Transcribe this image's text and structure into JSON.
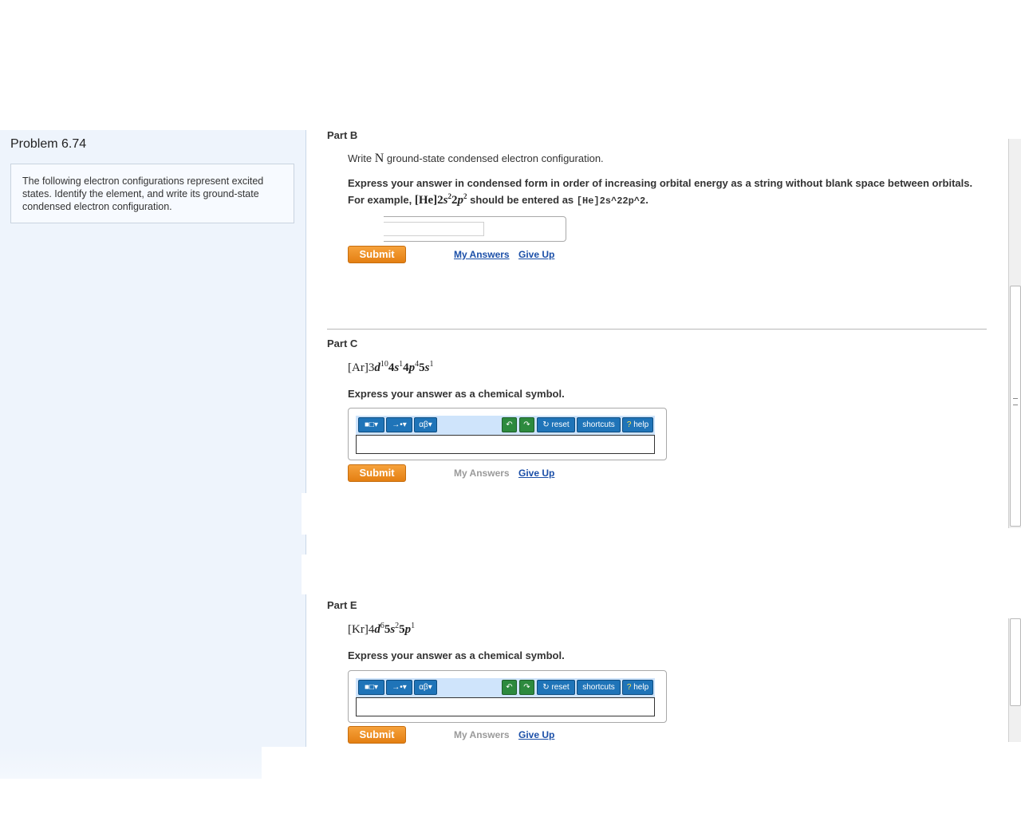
{
  "sidebar": {
    "title": "Problem 6.74",
    "description": "The following electron configurations represent excited states. Identify the element, and write its ground-state condensed electron configuration."
  },
  "part_b": {
    "title": "Part B",
    "q_prefix": "Write",
    "q_symbol": "N",
    "q_suffix": "ground-state condensed electron configuration.",
    "instruction_line1": "Express your answer in condensed form in order of increasing orbital energy as a string without blank space between orbitals.",
    "instruction_prefix": "For example,",
    "instruction_mid": "should be entered as",
    "example_code": "[He]2s^22p^2",
    "instruction_end": ".",
    "input_value": "",
    "submit_label": "Submit",
    "my_answers_label": "My Answers",
    "give_up_label": "Give Up"
  },
  "part_c": {
    "title": "Part C",
    "instruction": "Express your answer as a chemical symbol.",
    "submit_label": "Submit",
    "my_answers_label": "My Answers",
    "give_up_label": "Give Up"
  },
  "part_e": {
    "title": "Part E",
    "instruction": "Express your answer as a chemical symbol.",
    "submit_label": "Submit",
    "my_answers_label": "My Answers",
    "give_up_label": "Give Up"
  },
  "toolbar": {
    "templates_icon": "templates-icon",
    "arrow_icon": "arrow-icon",
    "greek_label": "αβ",
    "undo_icon": "undo-icon",
    "redo_icon": "redo-icon",
    "reset_label": "reset",
    "shortcuts_label": "shortcuts",
    "help_label": "help"
  },
  "colors": {
    "submit": "#e8891c",
    "link": "#1b4fa8",
    "sidebar_bg": "#eef4fc",
    "toolbar_bg": "#cfe4fb",
    "toolbar_btn": "#1f74b8"
  }
}
